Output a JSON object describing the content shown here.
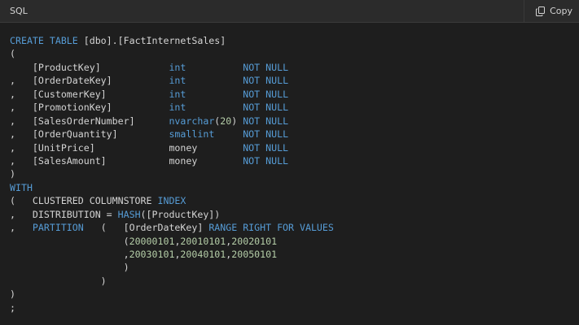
{
  "header": {
    "language": "SQL",
    "copy_label": "Copy",
    "copy_icon": "copy-icon"
  },
  "colors": {
    "background": "#1e1e1e",
    "header_background": "#2b2b2b",
    "text": "#d4d4d4",
    "keyword": "#569cd6",
    "number": "#b5cea8"
  },
  "code_lines": [
    [
      {
        "t": "CREATE TABLE",
        "c": "kw"
      },
      {
        "t": " [dbo].[FactInternetSales]",
        "c": "plain"
      }
    ],
    [
      {
        "t": "(",
        "c": "plain"
      }
    ],
    [
      {
        "t": "    [ProductKey]            ",
        "c": "plain"
      },
      {
        "t": "int",
        "c": "type"
      },
      {
        "t": "          ",
        "c": "plain"
      },
      {
        "t": "NOT NULL",
        "c": "kw"
      }
    ],
    [
      {
        "t": ",   [OrderDateKey]          ",
        "c": "plain"
      },
      {
        "t": "int",
        "c": "type"
      },
      {
        "t": "          ",
        "c": "plain"
      },
      {
        "t": "NOT NULL",
        "c": "kw"
      }
    ],
    [
      {
        "t": ",   [CustomerKey]           ",
        "c": "plain"
      },
      {
        "t": "int",
        "c": "type"
      },
      {
        "t": "          ",
        "c": "plain"
      },
      {
        "t": "NOT NULL",
        "c": "kw"
      }
    ],
    [
      {
        "t": ",   [PromotionKey]          ",
        "c": "plain"
      },
      {
        "t": "int",
        "c": "type"
      },
      {
        "t": "          ",
        "c": "plain"
      },
      {
        "t": "NOT NULL",
        "c": "kw"
      }
    ],
    [
      {
        "t": ",   [SalesOrderNumber]      ",
        "c": "plain"
      },
      {
        "t": "nvarchar",
        "c": "type"
      },
      {
        "t": "(",
        "c": "plain"
      },
      {
        "t": "20",
        "c": "num"
      },
      {
        "t": ") ",
        "c": "plain"
      },
      {
        "t": "NOT NULL",
        "c": "kw"
      }
    ],
    [
      {
        "t": ",   [OrderQuantity]         ",
        "c": "plain"
      },
      {
        "t": "smallint",
        "c": "type"
      },
      {
        "t": "     ",
        "c": "plain"
      },
      {
        "t": "NOT NULL",
        "c": "kw"
      }
    ],
    [
      {
        "t": ",   [UnitPrice]             money        ",
        "c": "plain"
      },
      {
        "t": "NOT NULL",
        "c": "kw"
      }
    ],
    [
      {
        "t": ",   [SalesAmount]           money        ",
        "c": "plain"
      },
      {
        "t": "NOT NULL",
        "c": "kw"
      }
    ],
    [
      {
        "t": ")",
        "c": "plain"
      }
    ],
    [
      {
        "t": "WITH",
        "c": "kw"
      }
    ],
    [
      {
        "t": "(   CLUSTERED COLUMNSTORE ",
        "c": "plain"
      },
      {
        "t": "INDEX",
        "c": "kw"
      }
    ],
    [
      {
        "t": ",   DISTRIBUTION = ",
        "c": "plain"
      },
      {
        "t": "HASH",
        "c": "func"
      },
      {
        "t": "([ProductKey])",
        "c": "plain"
      }
    ],
    [
      {
        "t": ",   ",
        "c": "plain"
      },
      {
        "t": "PARTITION",
        "c": "kw"
      },
      {
        "t": "   (   [OrderDateKey] ",
        "c": "plain"
      },
      {
        "t": "RANGE RIGHT FOR VALUES",
        "c": "kw"
      }
    ],
    [
      {
        "t": "                    (",
        "c": "plain"
      },
      {
        "t": "20000101",
        "c": "num"
      },
      {
        "t": ",",
        "c": "plain"
      },
      {
        "t": "20010101",
        "c": "num"
      },
      {
        "t": ",",
        "c": "plain"
      },
      {
        "t": "20020101",
        "c": "num"
      }
    ],
    [
      {
        "t": "                    ,",
        "c": "plain"
      },
      {
        "t": "20030101",
        "c": "num"
      },
      {
        "t": ",",
        "c": "plain"
      },
      {
        "t": "20040101",
        "c": "num"
      },
      {
        "t": ",",
        "c": "plain"
      },
      {
        "t": "20050101",
        "c": "num"
      }
    ],
    [
      {
        "t": "                    )",
        "c": "plain"
      }
    ],
    [
      {
        "t": "                )",
        "c": "plain"
      }
    ],
    [
      {
        "t": ")",
        "c": "plain"
      }
    ],
    [
      {
        "t": ";",
        "c": "plain"
      }
    ]
  ]
}
